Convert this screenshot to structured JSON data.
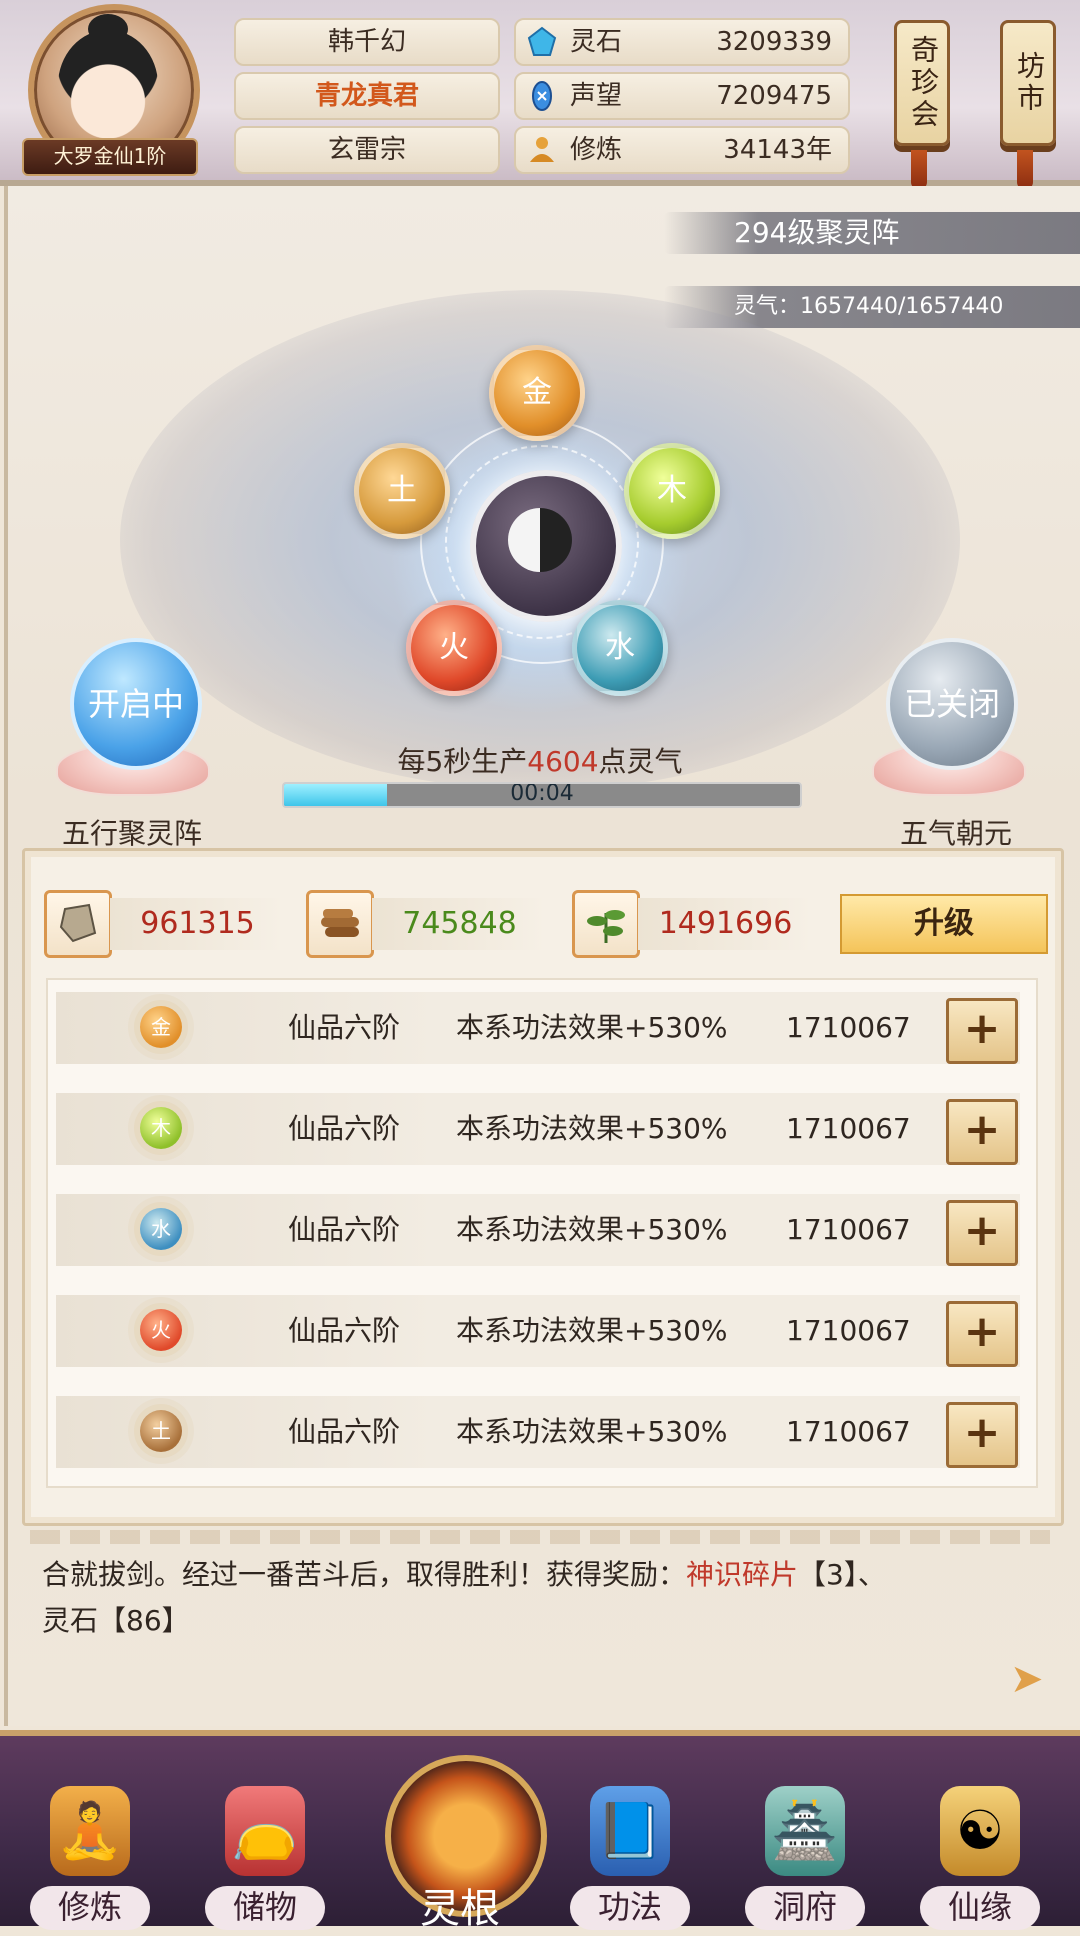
{
  "header": {
    "player_name": "韩千幻",
    "title": "青龙真君",
    "sect": "玄雷宗",
    "rank": "大罗金仙1阶",
    "stats": [
      {
        "icon": "spirit-stone-icon",
        "label": "灵石",
        "value": "3209339"
      },
      {
        "icon": "reputation-icon",
        "label": "声望",
        "value": "7209475"
      },
      {
        "icon": "cultivation-icon",
        "label": "修炼",
        "value": "34143年"
      }
    ],
    "tabs": [
      "奇珍会",
      "坊市"
    ]
  },
  "array": {
    "level_label": "294级聚灵阵",
    "qi_label": "灵气：1657440/1657440",
    "elements": {
      "gold": "金",
      "wood": "木",
      "water": "水",
      "fire": "火",
      "earth": "土"
    },
    "left_switch": {
      "state": "开启中",
      "name": "五行聚灵阵"
    },
    "right_switch": {
      "state": "已关闭",
      "name": "五气朝元"
    },
    "production_prefix": "每5秒生产",
    "production_value": "4604",
    "production_suffix": "点灵气",
    "timer": "00:04",
    "progress": 0.2
  },
  "resources": [
    {
      "icon": "ore-icon",
      "value": "961315",
      "color": "#b02a1e"
    },
    {
      "icon": "wood-icon",
      "value": "745848",
      "color": "#4a8a1c"
    },
    {
      "icon": "herb-icon",
      "value": "1491696",
      "color": "#b02a1e"
    }
  ],
  "upgrade_label": "升级",
  "element_rows": [
    {
      "element": "金",
      "grade": "仙品六阶",
      "effect": "本系功法效果+530%",
      "cost": "1710067"
    },
    {
      "element": "木",
      "grade": "仙品六阶",
      "effect": "本系功法效果+530%",
      "cost": "1710067"
    },
    {
      "element": "水",
      "grade": "仙品六阶",
      "effect": "本系功法效果+530%",
      "cost": "1710067"
    },
    {
      "element": "火",
      "grade": "仙品六阶",
      "effect": "本系功法效果+530%",
      "cost": "1710067"
    },
    {
      "element": "土",
      "grade": "仙品六阶",
      "effect": "本系功法效果+530%",
      "cost": "1710067"
    }
  ],
  "plus_label": "+",
  "message": {
    "part1": "合就拔剑。经过一番苦斗后，取得胜利！获得奖励：",
    "highlight": "神识碎片",
    "part2": "【3】、",
    "line2": "灵石【86】"
  },
  "nav": [
    {
      "icon": "cultivate-icon",
      "label": "修炼"
    },
    {
      "icon": "storage-icon",
      "label": "储物"
    },
    {
      "icon": "spirit-root-icon",
      "label": "灵根"
    },
    {
      "icon": "technique-icon",
      "label": "功法"
    },
    {
      "icon": "cave-icon",
      "label": "洞府"
    },
    {
      "icon": "fate-icon",
      "label": "仙缘"
    }
  ]
}
